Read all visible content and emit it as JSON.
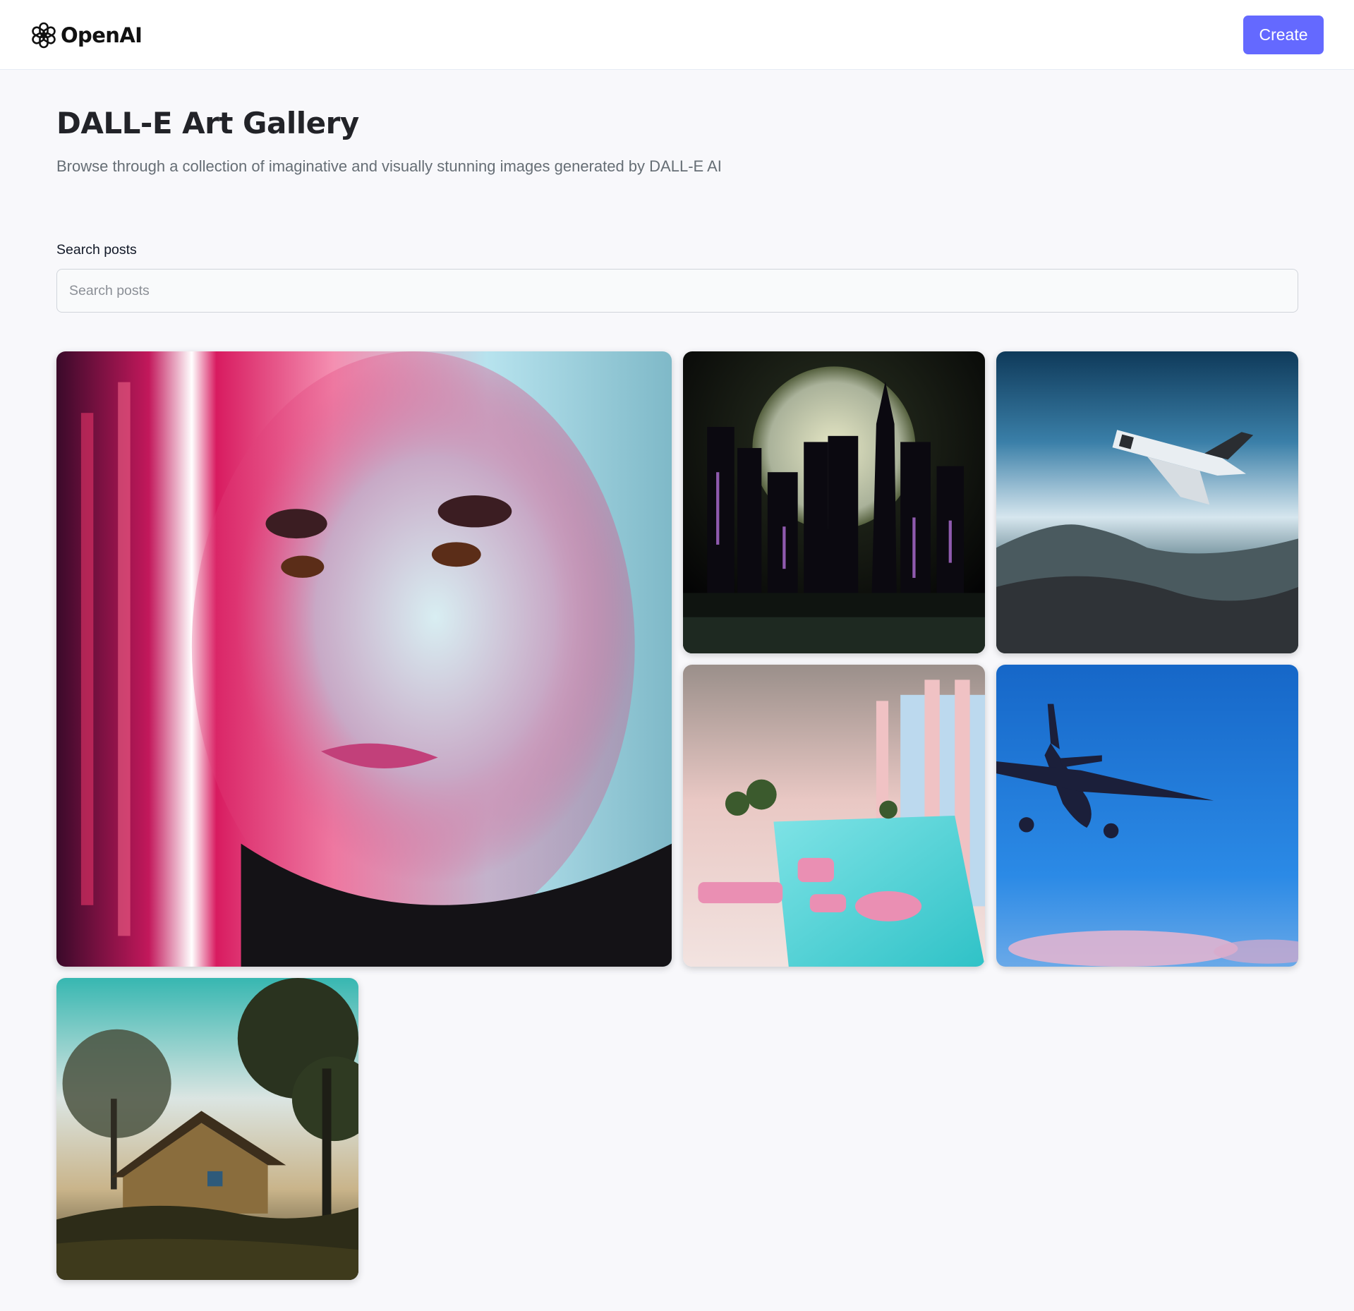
{
  "header": {
    "brand": "OpenAI",
    "logo_icon": "openai-logo-icon",
    "create_label": "Create",
    "accent_color": "#6469ff"
  },
  "main": {
    "title": "DALL-E Art Gallery",
    "subtitle": "Browse through a collection of imaginative and visually stunning images generated by DALL-E AI",
    "search": {
      "label": "Search posts",
      "placeholder": "Search posts",
      "value": ""
    }
  },
  "gallery": {
    "images": [
      {
        "subject": "neon-portrait-woman-image"
      },
      {
        "subject": "moonlit-city-skyline-image"
      },
      {
        "subject": "space-shuttle-over-city-image"
      },
      {
        "subject": "pink-poolside-lounge-image"
      },
      {
        "subject": "airplane-blue-sky-image"
      },
      {
        "subject": "hilltop-house-trees-image"
      }
    ]
  }
}
